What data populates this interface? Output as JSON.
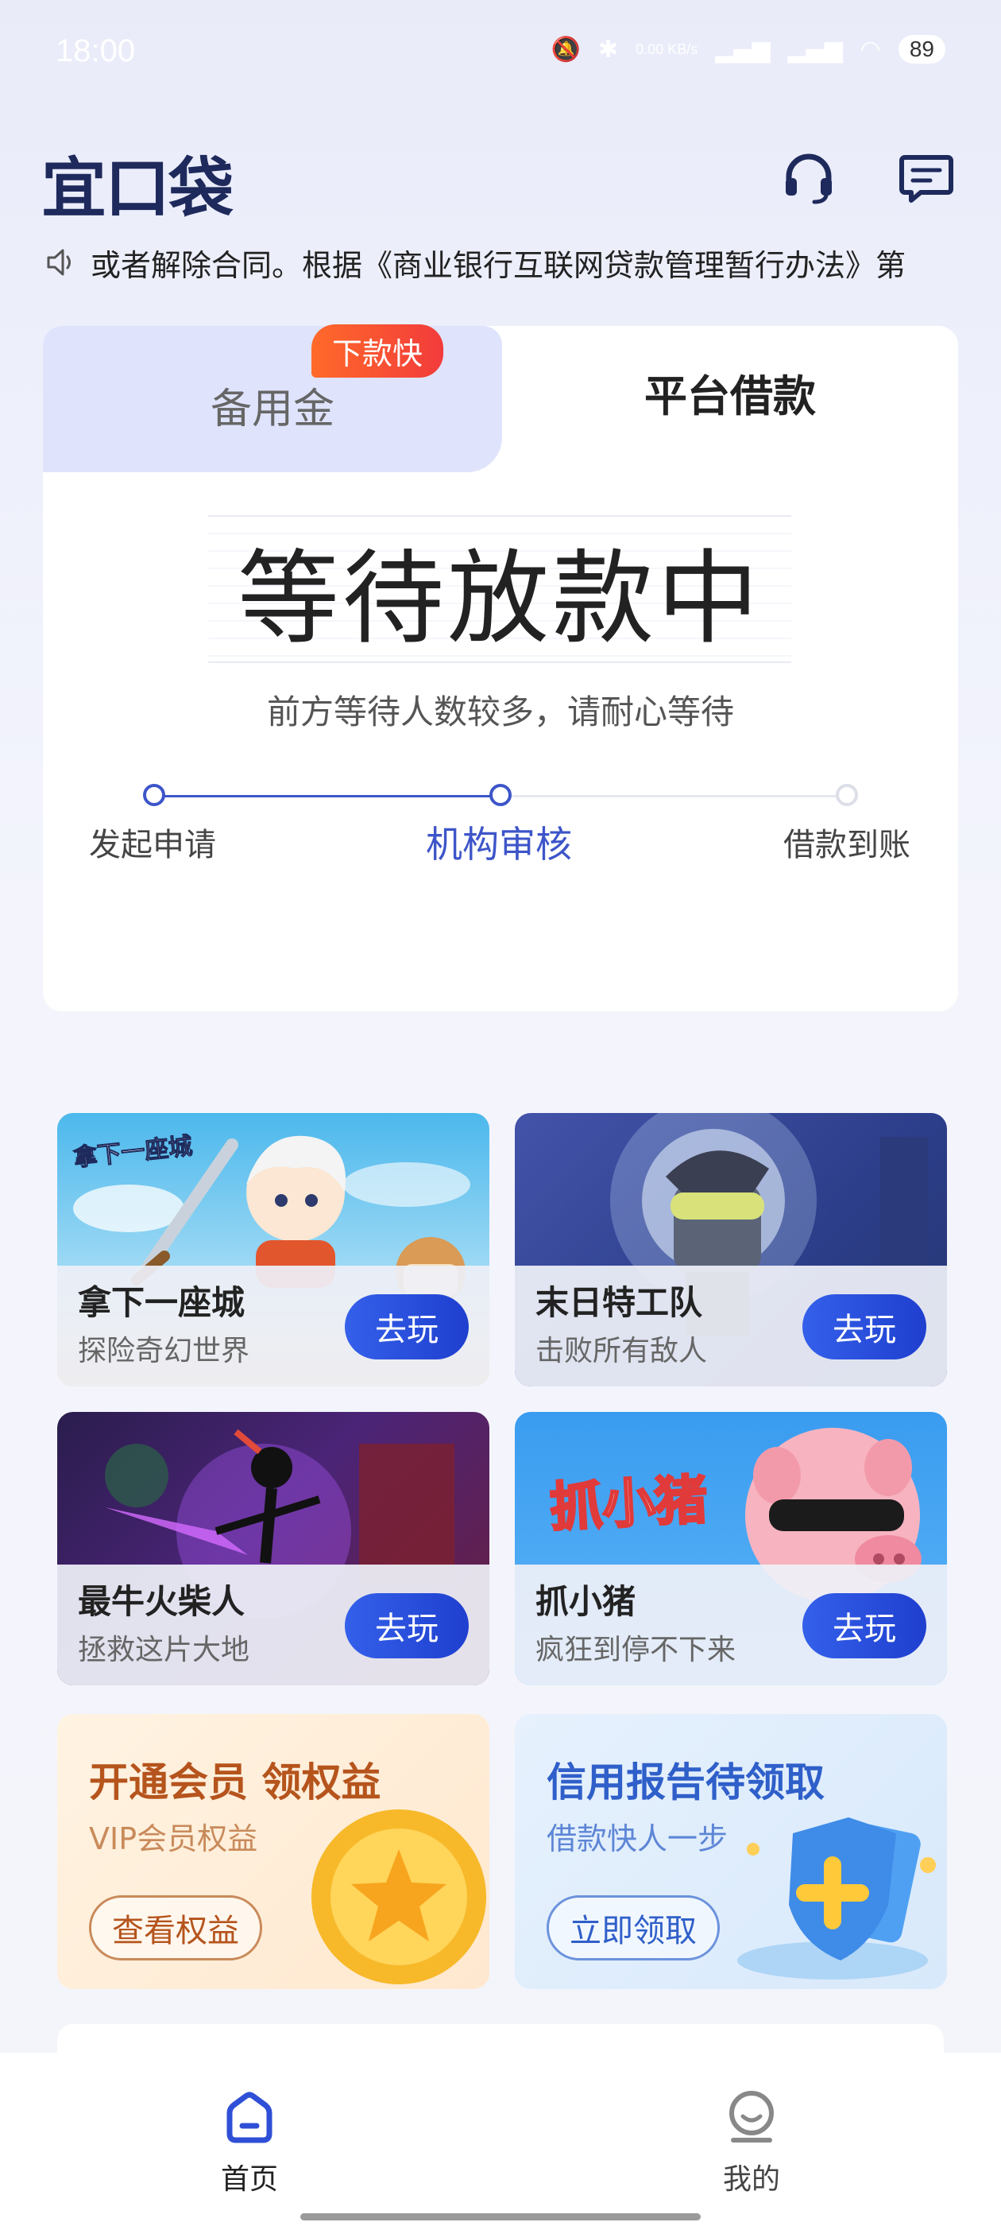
{
  "status_bar": {
    "time": "18:00",
    "network_speed": "0.00 KB/s",
    "battery": "89"
  },
  "header": {
    "logo": "宜口袋"
  },
  "notice": {
    "text": "或者解除合同。根据《商业银行互联网贷款管理暂行办法》第"
  },
  "loan_card": {
    "tabs": [
      {
        "label": "备用金",
        "badge": "下款快"
      },
      {
        "label": "平台借款"
      }
    ],
    "status_title": "等待放款中",
    "status_subtitle": "前方等待人数较多，请耐心等待",
    "steps": [
      {
        "label": "发起申请"
      },
      {
        "label": "机构审核"
      },
      {
        "label": "借款到账"
      }
    ]
  },
  "games": [
    {
      "name": "拿下一座城",
      "desc": "探险奇幻世界",
      "button": "去玩",
      "art_text": "拿下一座城"
    },
    {
      "name": "末日特工队",
      "desc": "击败所有敌人",
      "button": "去玩"
    },
    {
      "name": "最牛火柴人",
      "desc": "拯救这片大地",
      "button": "去玩"
    },
    {
      "name": "抓小猪",
      "desc": "疯狂到停不下来",
      "button": "去玩",
      "art_text": "抓小猪"
    }
  ],
  "promos": [
    {
      "title": "开通会员 领权益",
      "subtitle": "VIP会员权益",
      "button": "查看权益"
    },
    {
      "title": "信用报告待领取",
      "subtitle": "借款快人一步",
      "button": "立即领取"
    }
  ],
  "bottom_nav": [
    {
      "label": "首页",
      "active": true
    },
    {
      "label": "我的",
      "active": false
    }
  ],
  "colors": {
    "primary": "#2f4fd6",
    "active_step": "#3d55c9",
    "badge": "#f2502f",
    "promo_vip": "#b5541c",
    "promo_credit": "#2f5fc9"
  }
}
